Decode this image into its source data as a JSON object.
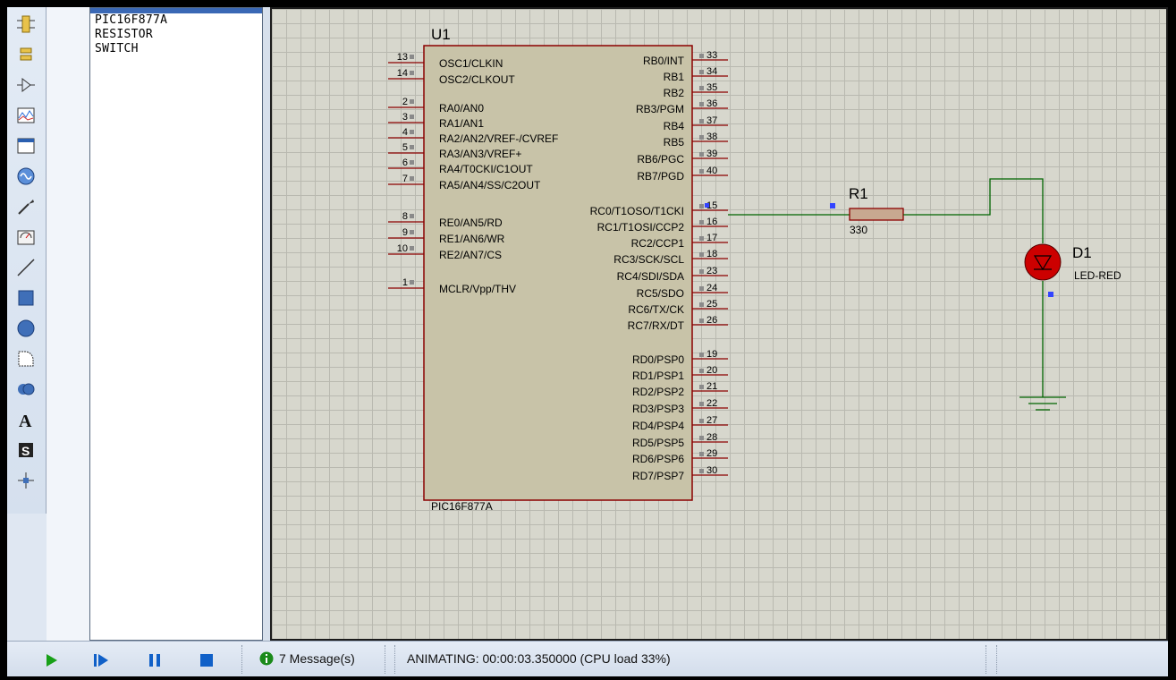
{
  "tools": [
    "component-mode-icon",
    "junction-dot-icon",
    "wire-label-icon",
    "graph-icon",
    "tape-recorder-icon",
    "generator-icon",
    "voltage-probe-icon",
    "virtual-instrument-icon",
    "line-icon",
    "box-icon",
    "circle-icon",
    "arc-icon",
    "path-icon",
    "text-icon",
    "symbol-icon",
    "marker-icon"
  ],
  "device_list": {
    "items": [
      "PIC16F877A",
      "RESISTOR",
      "SWITCH"
    ]
  },
  "schematic": {
    "mcu": {
      "ref": "U1",
      "part": "PIC16F877A",
      "left_pins": [
        {
          "num": "13",
          "name": "OSC1/CLKIN"
        },
        {
          "num": "14",
          "name": "OSC2/CLKOUT"
        },
        {
          "num": "2",
          "name": "RA0/AN0"
        },
        {
          "num": "3",
          "name": "RA1/AN1"
        },
        {
          "num": "4",
          "name": "RA2/AN2/VREF-/CVREF"
        },
        {
          "num": "5",
          "name": "RA3/AN3/VREF+"
        },
        {
          "num": "6",
          "name": "RA4/T0CKI/C1OUT"
        },
        {
          "num": "7",
          "name": "RA5/AN4/SS/C2OUT"
        },
        {
          "num": "8",
          "name": "RE0/AN5/RD"
        },
        {
          "num": "9",
          "name": "RE1/AN6/WR"
        },
        {
          "num": "10",
          "name": "RE2/AN7/CS"
        },
        {
          "num": "1",
          "name": "MCLR/Vpp/THV"
        }
      ],
      "right_pins": [
        {
          "num": "33",
          "name": "RB0/INT"
        },
        {
          "num": "34",
          "name": "RB1"
        },
        {
          "num": "35",
          "name": "RB2"
        },
        {
          "num": "36",
          "name": "RB3/PGM"
        },
        {
          "num": "37",
          "name": "RB4"
        },
        {
          "num": "38",
          "name": "RB5"
        },
        {
          "num": "39",
          "name": "RB6/PGC"
        },
        {
          "num": "40",
          "name": "RB7/PGD"
        },
        {
          "num": "15",
          "name": "RC0/T1OSO/T1CKI"
        },
        {
          "num": "16",
          "name": "RC1/T1OSI/CCP2"
        },
        {
          "num": "17",
          "name": "RC2/CCP1"
        },
        {
          "num": "18",
          "name": "RC3/SCK/SCL"
        },
        {
          "num": "23",
          "name": "RC4/SDI/SDA"
        },
        {
          "num": "24",
          "name": "RC5/SDO"
        },
        {
          "num": "25",
          "name": "RC6/TX/CK"
        },
        {
          "num": "26",
          "name": "RC7/RX/DT"
        },
        {
          "num": "19",
          "name": "RD0/PSP0"
        },
        {
          "num": "20",
          "name": "RD1/PSP1"
        },
        {
          "num": "21",
          "name": "RD2/PSP2"
        },
        {
          "num": "22",
          "name": "RD3/PSP3"
        },
        {
          "num": "27",
          "name": "RD4/PSP4"
        },
        {
          "num": "28",
          "name": "RD5/PSP5"
        },
        {
          "num": "29",
          "name": "RD6/PSP6"
        },
        {
          "num": "30",
          "name": "RD7/PSP7"
        }
      ]
    },
    "resistor": {
      "ref": "R1",
      "value": "330"
    },
    "led": {
      "ref": "D1",
      "value": "LED-RED"
    }
  },
  "statusbar": {
    "messages": "7 Message(s)",
    "status": "ANIMATING: 00:00:03.350000 (CPU load 33%)"
  },
  "colors": {
    "wire": "#006400",
    "chip_body": "#c8c3a8",
    "chip_border": "#8b0000",
    "pin": "#8b0000",
    "led": "#cc0000",
    "play": "#18a018",
    "control_blue": "#1060c8"
  }
}
